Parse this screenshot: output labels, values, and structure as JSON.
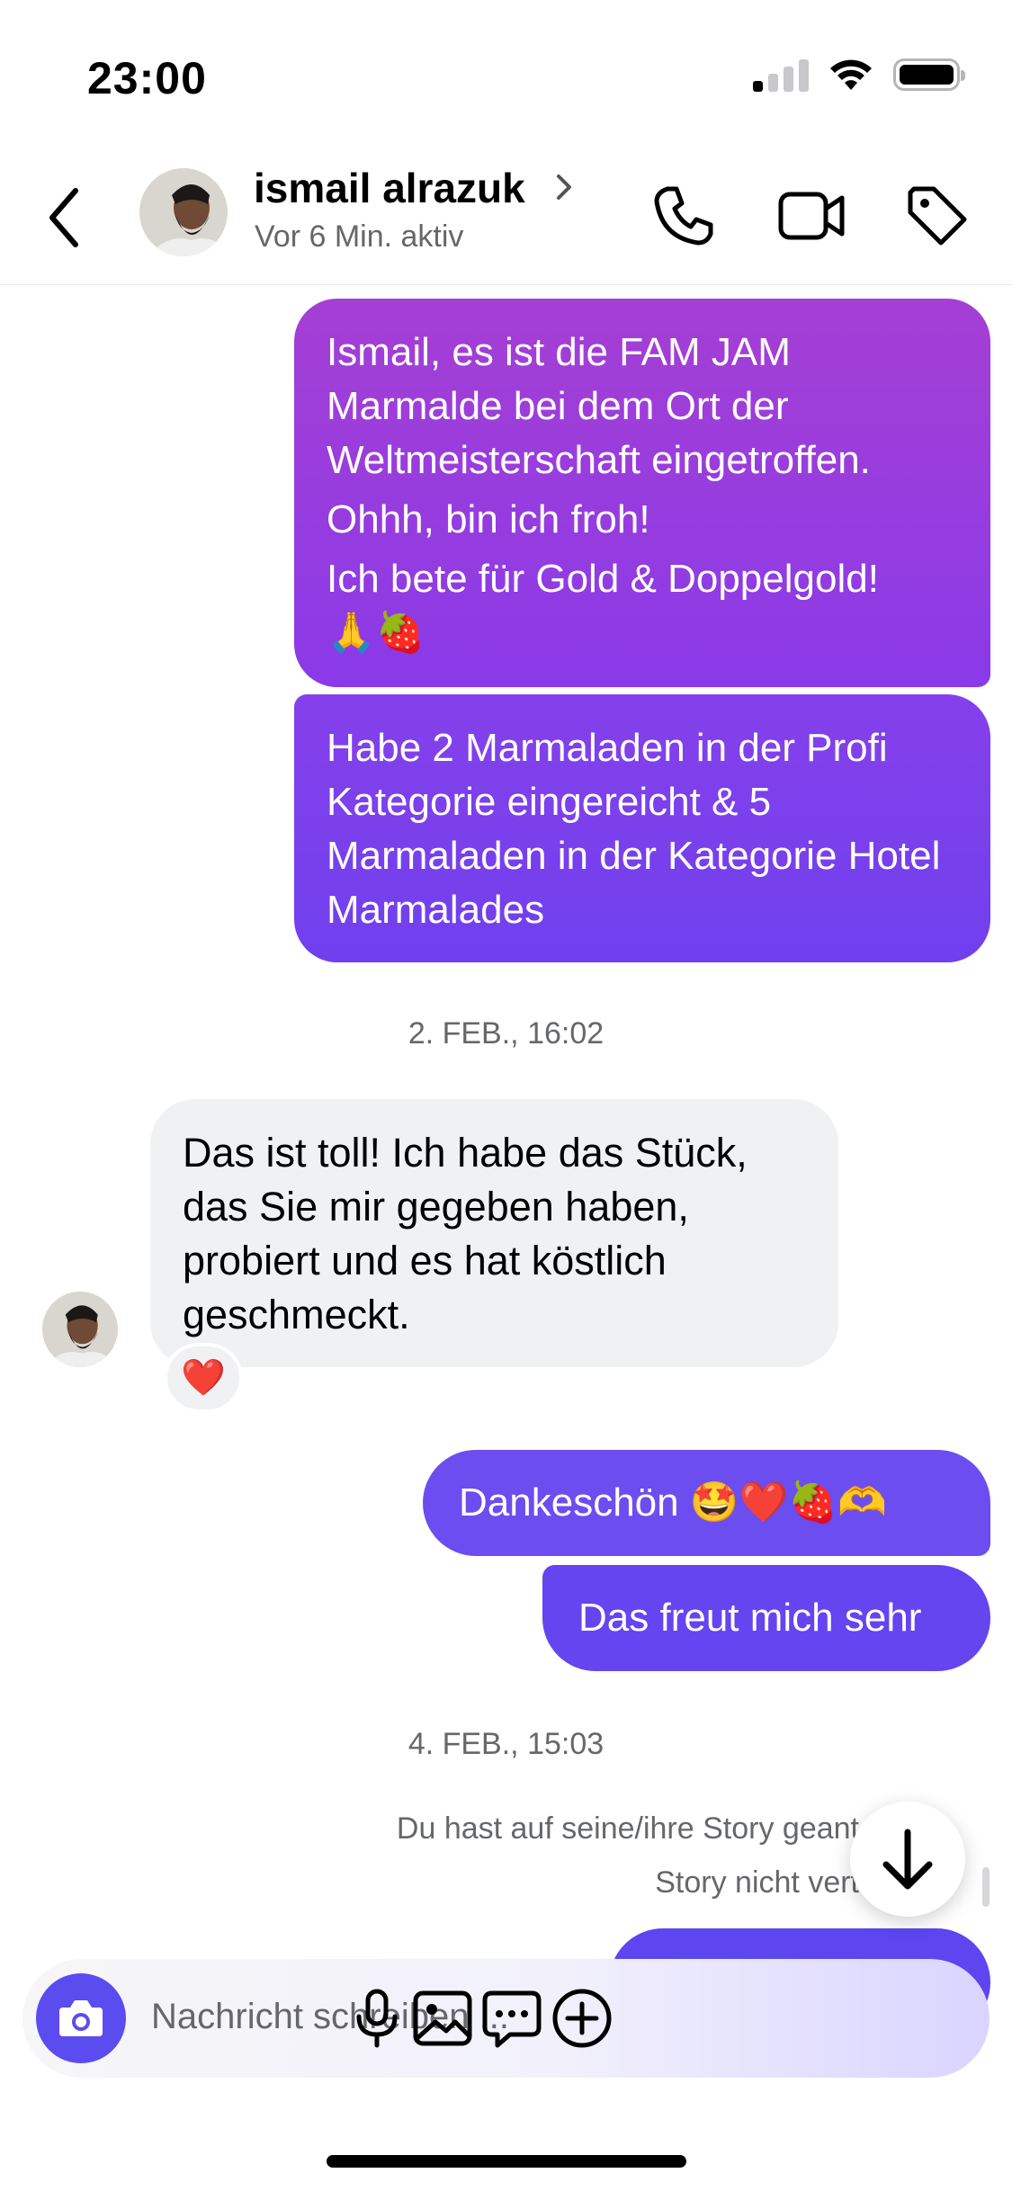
{
  "status_bar": {
    "time": "23:00"
  },
  "header": {
    "contact_name": "ismail alrazuk",
    "activity": "Vor 6 Min. aktiv"
  },
  "messages": {
    "m1_lines": [
      "Ismail, es ist die FAM JAM",
      "Marmalde bei dem Ort der",
      "Weltmeisterschaft eingetroffen.",
      "Ohhh, bin ich froh!",
      "Ich bete für Gold & Doppelgold!",
      "🙏🍓"
    ],
    "m2": "Habe 2 Marmaladen in der Profi Kategorie eingereicht & 5 Marmaladen in der Kategorie Hotel Marmalades",
    "timestamp_1": "2. FEB., 16:02",
    "m3": "Das ist toll! Ich habe das Stück, das Sie mir gegeben haben, probiert und es hat köstlich geschmeckt.",
    "m3_reaction": "❤️",
    "m4": "Dankeschön 🤩❤️🍓🫶",
    "m5": "Das freut mich sehr",
    "timestamp_2": "4. FEB., 15:03",
    "story_notice_line1": "Du hast auf seine/ihre Story geant",
    "story_notice_line2": "Story nicht vert"
  },
  "composer": {
    "placeholder": "Nachricht schreiben ..."
  },
  "colors": {
    "accent": "#5b4cf0",
    "bubble_purple": "#a53fd4",
    "bubble_violet": "#6b4df0",
    "incoming_bubble": "#f0f1f3",
    "meta_text": "#65676b"
  },
  "icons": [
    "back-chevron-icon",
    "chevron-right-icon",
    "phone-icon",
    "video-camera-icon",
    "tag-icon",
    "arrow-down-icon",
    "camera-icon",
    "microphone-icon",
    "image-icon",
    "sticker-chat-icon",
    "plus-circle-icon"
  ]
}
